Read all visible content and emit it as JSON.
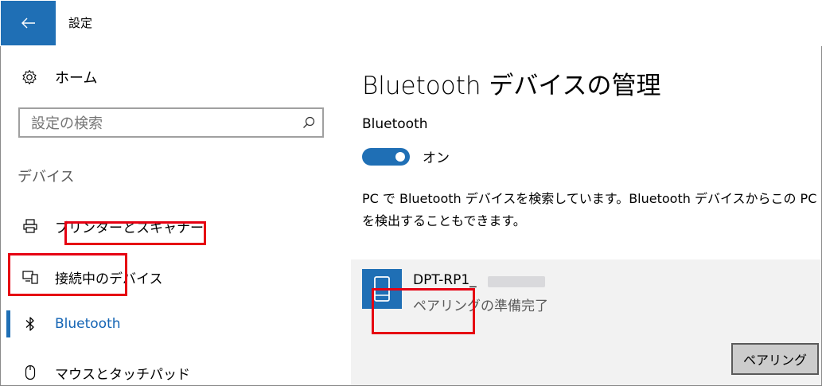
{
  "window": {
    "title": "設定"
  },
  "sidebar": {
    "home_label": "ホーム",
    "search_placeholder": "設定の検索",
    "section_header": "デバイス",
    "items": [
      {
        "label": "プリンターとスキャナー",
        "icon": "printer-icon",
        "selected": false
      },
      {
        "label": "接続中のデバイス",
        "icon": "connected-devices-icon",
        "selected": false
      },
      {
        "label": "Bluetooth",
        "icon": "bluetooth-icon",
        "selected": true
      },
      {
        "label": "マウスとタッチパッド",
        "icon": "mouse-icon",
        "selected": false
      }
    ]
  },
  "main": {
    "title": "Bluetooth デバイスの管理",
    "bluetooth_label": "Bluetooth",
    "toggle_state": "オン",
    "description": "PC で Bluetooth デバイスを検索しています。Bluetooth デバイスからこの PC\nを検出することもできます。",
    "device": {
      "name": "DPT-RP1_",
      "status": "ペアリングの準備完了",
      "pair_button": "ペアリング"
    }
  },
  "colors": {
    "accent": "#1f6fb5",
    "highlight": "#e60012",
    "selected_text": "#1565b5"
  }
}
